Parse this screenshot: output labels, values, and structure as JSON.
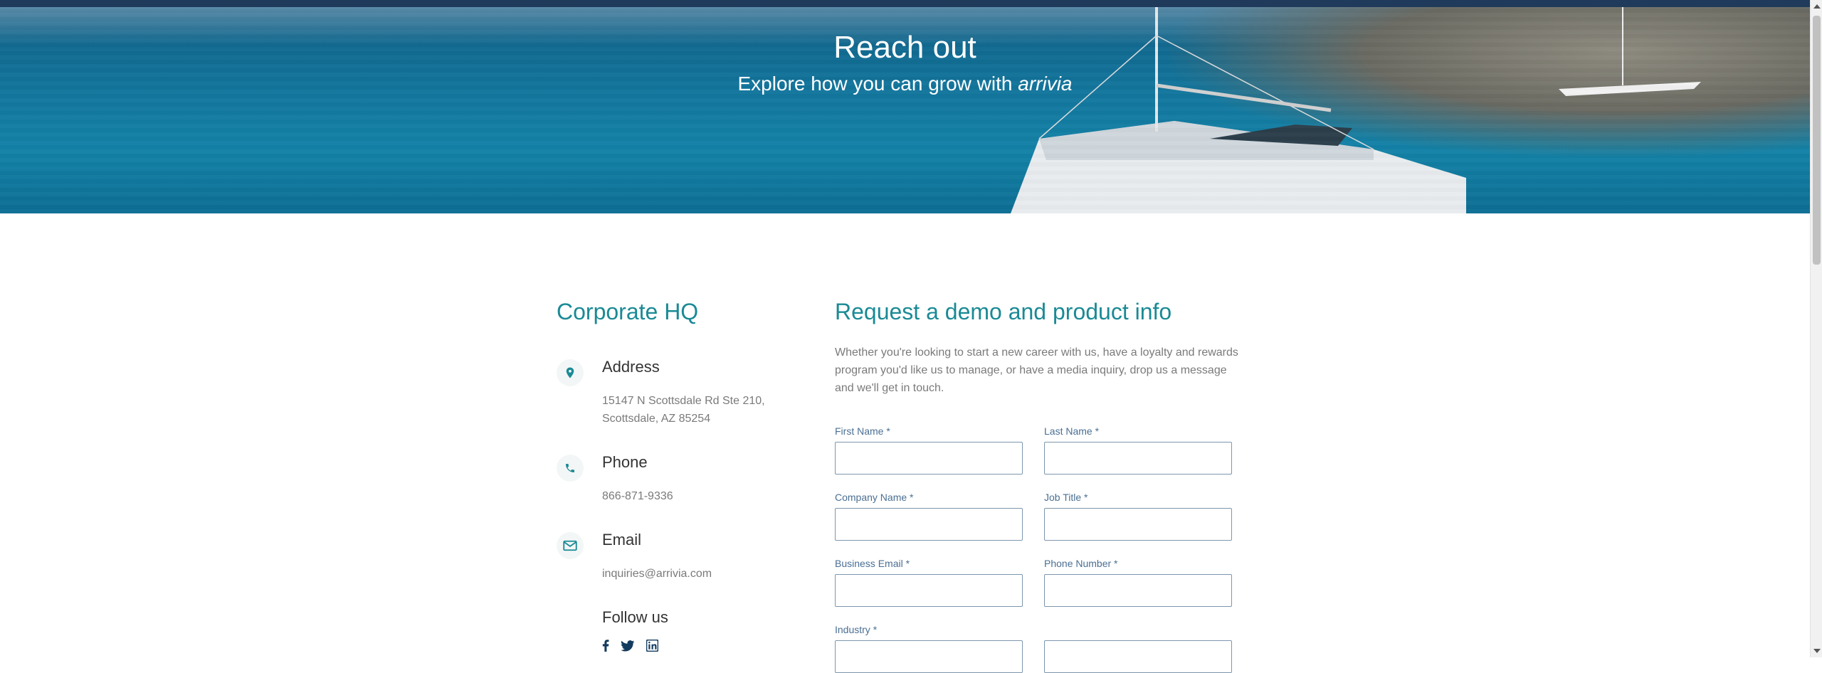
{
  "hero": {
    "title": "Reach out",
    "subtitle_prefix": "Explore how you can grow with ",
    "subtitle_brand": "arrivia"
  },
  "corporate": {
    "title": "Corporate HQ",
    "address": {
      "label": "Address",
      "line1": "15147 N Scottsdale Rd Ste 210,",
      "line2": "Scottsdale, AZ 85254"
    },
    "phone": {
      "label": "Phone",
      "value": "866-871-9336"
    },
    "email": {
      "label": "Email",
      "value": "inquiries@arrivia.com"
    },
    "follow": {
      "label": "Follow us",
      "networks": [
        "facebook",
        "twitter",
        "linkedin"
      ]
    }
  },
  "form": {
    "title": "Request a demo and product info",
    "description": "Whether you're looking to start a new career with us, have a loyalty and rewards program you'd like us to manage, or have a media inquiry, drop us a message and we'll get in touch.",
    "fields": {
      "first_name": "First Name *",
      "last_name": "Last Name *",
      "company_name": "Company Name *",
      "job_title": "Job Title *",
      "business_email": "Business Email *",
      "phone_number": "Phone Number *",
      "industry": "Industry *"
    }
  },
  "colors": {
    "accent": "#1a8a95",
    "label": "#4a6f93",
    "topbar": "#1f3a5a"
  }
}
